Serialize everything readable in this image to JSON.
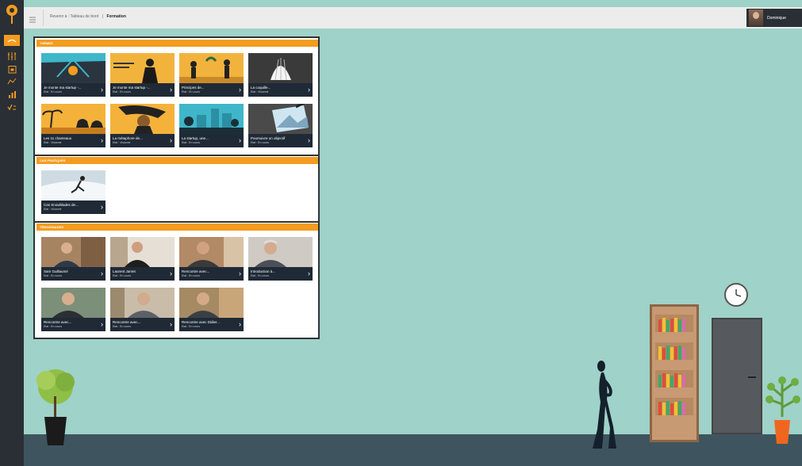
{
  "topbar": {
    "back_label": "Revenir à : Tableau de bord",
    "separator": "|",
    "current_page": "Formation"
  },
  "user": {
    "name": "Dominique"
  },
  "sections": [
    {
      "title": "THÈMES",
      "cards": [
        {
          "title": "Je monte ma startup -...",
          "status": "Etat : En cours",
          "thumb": "startup-scene-1"
        },
        {
          "title": "Je monte ma startup -...",
          "status": "Etat : En cours",
          "thumb": "startup-scene-2"
        },
        {
          "title": "Principes de...",
          "status": "Etat : En cours",
          "thumb": "principles-scene"
        },
        {
          "title": "La coquille...",
          "status": "Etat : Visionné",
          "thumb": "shell-scene"
        },
        {
          "title": "Les 11 chameaux",
          "status": "Etat : Visionné",
          "thumb": "camels-scene"
        },
        {
          "title": "La métaphore de...",
          "status": "Etat : Visionné",
          "thumb": "metaphor-scene"
        },
        {
          "title": "La startup, une...",
          "status": "Etat : En cours",
          "thumb": "city-scene"
        },
        {
          "title": "Poursuivre un objectif",
          "status": "Etat : En cours",
          "thumb": "goal-scene"
        }
      ]
    },
    {
      "title": "CAS PRATIQUES",
      "cards": [
        {
          "title": "Cas Snowblades de...",
          "status": "Etat : Visionné",
          "thumb": "snow-scene"
        }
      ]
    },
    {
      "title": "TÉMOIGNAGES",
      "cards": [
        {
          "title": "Sam Guillaumé",
          "status": "Etat : En cours",
          "thumb": "portrait-1"
        },
        {
          "title": "Laurent Jamet",
          "status": "Etat : En cours",
          "thumb": "portrait-2"
        },
        {
          "title": "Rencontre avec...",
          "status": "Etat : En cours",
          "thumb": "portrait-3"
        },
        {
          "title": "Introduction à...",
          "status": "Etat : En cours",
          "thumb": "portrait-4"
        },
        {
          "title": "Rencontre avec...",
          "status": "Etat : En cours",
          "thumb": "portrait-5"
        },
        {
          "title": "Rencontre avec...",
          "status": "Etat : En cours",
          "thumb": "portrait-6"
        },
        {
          "title": "Rencontre avec Didier...",
          "status": "Etat : En cours",
          "thumb": "portrait-7"
        }
      ]
    }
  ],
  "colors": {
    "accent": "#f39c1f",
    "sidebar": "#2a2f36",
    "scene_wall": "#9fd2c8",
    "scene_floor": "#3e5560",
    "caption_bg": "#1f2a36"
  },
  "icons": {
    "sidebar": [
      "logo-icon",
      "video-icon",
      "tools-icon",
      "calendar-icon",
      "graph-icon",
      "chart-icon",
      "checklist-icon"
    ],
    "card_chevron": "›"
  }
}
